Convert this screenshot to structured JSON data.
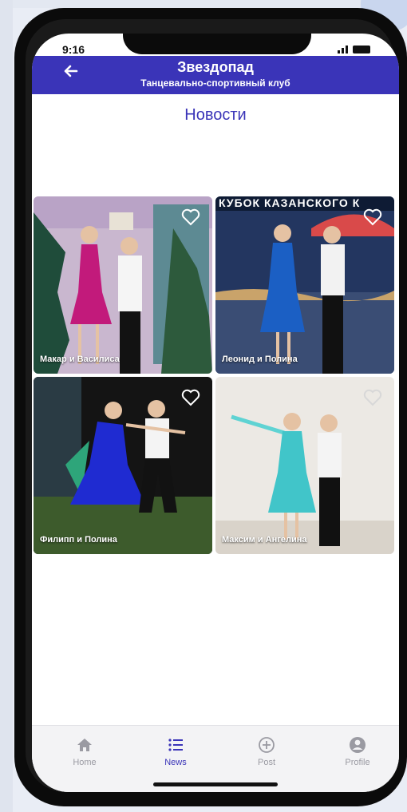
{
  "status_bar": {
    "time": "9:16"
  },
  "header": {
    "title": "Звездопад",
    "subtitle": "Танцевально-спортивный клуб",
    "back_icon": "arrow-left-icon"
  },
  "page": {
    "title": "Новости"
  },
  "news_cards": [
    {
      "caption": "Макар и Василиса"
    },
    {
      "caption": "Леонид и Полина",
      "banner": "КУБОК КАЗАНСКОГО К"
    },
    {
      "caption": "Филипп и Полина"
    },
    {
      "caption": "Максим и Ангелина"
    }
  ],
  "tabbar": {
    "tabs": [
      {
        "label": "Home",
        "icon": "home-icon"
      },
      {
        "label": "News",
        "icon": "list-icon",
        "active": true
      },
      {
        "label": "Post",
        "icon": "plus-circle-icon"
      },
      {
        "label": "Profile",
        "icon": "user-circle-icon"
      }
    ]
  },
  "colors": {
    "accent": "#3a34b8",
    "inactive_tab": "#9a9aa2",
    "tabbar_bg": "#f3f3f5"
  }
}
